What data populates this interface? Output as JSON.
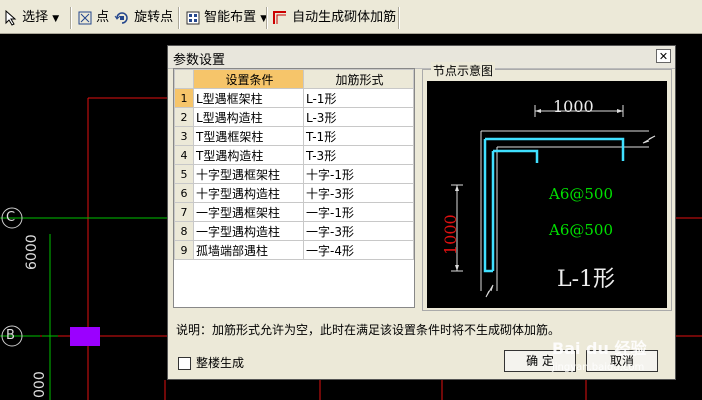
{
  "toolbar": {
    "select_label": "选择",
    "point_label": "点",
    "rotate_point_label": "旋转点",
    "smart_layout_label": "智能布置",
    "auto_gen_label": "自动生成砌体加筋"
  },
  "canvas": {
    "axis_c": "C",
    "axis_b": "B",
    "dim_6000": "6000",
    "dim_000": "000"
  },
  "dialog": {
    "title": "参数设置",
    "close": "✕",
    "table": {
      "headers": [
        "设置条件",
        "加筋形式"
      ],
      "rows": [
        {
          "n": "1",
          "cond": "L型遇框架柱",
          "form": "L-1形"
        },
        {
          "n": "2",
          "cond": "L型遇构造柱",
          "form": "L-3形"
        },
        {
          "n": "3",
          "cond": "T型遇框架柱",
          "form": "T-1形"
        },
        {
          "n": "4",
          "cond": "T型遇构造柱",
          "form": "T-3形"
        },
        {
          "n": "5",
          "cond": "十字型遇框架柱",
          "form": "十字-1形"
        },
        {
          "n": "6",
          "cond": "十字型遇构造柱",
          "form": "十字-3形"
        },
        {
          "n": "7",
          "cond": "一字型遇框架柱",
          "form": "一字-1形"
        },
        {
          "n": "8",
          "cond": "一字型遇构造柱",
          "form": "一字-3形"
        },
        {
          "n": "9",
          "cond": "孤墙端部遇柱",
          "form": "一字-4形"
        }
      ]
    },
    "preview": {
      "group_title": "节点示意图",
      "dim_h": "1000",
      "dim_v": "1000",
      "rebar1": "A6@500",
      "rebar2": "A6@500",
      "shape_label": "L-1形"
    },
    "note": "说明：加筋形式允许为空，此时在满足该设置条件时将不生成砌体加筋。",
    "whole_floor_label": "整楼生成",
    "ok_label": "确 定",
    "cancel_label": "取消"
  },
  "watermark": "Bai du 经验",
  "watermark_url": "jingyan.baidu.com",
  "colors": {
    "grid_red": "#e01010",
    "axis_green": "#00c000",
    "rebar_cyan": "#40e0ff",
    "text_green": "#00e000",
    "highlight_orange": "#f6c56a",
    "marker_magenta": "#9b00ff"
  }
}
